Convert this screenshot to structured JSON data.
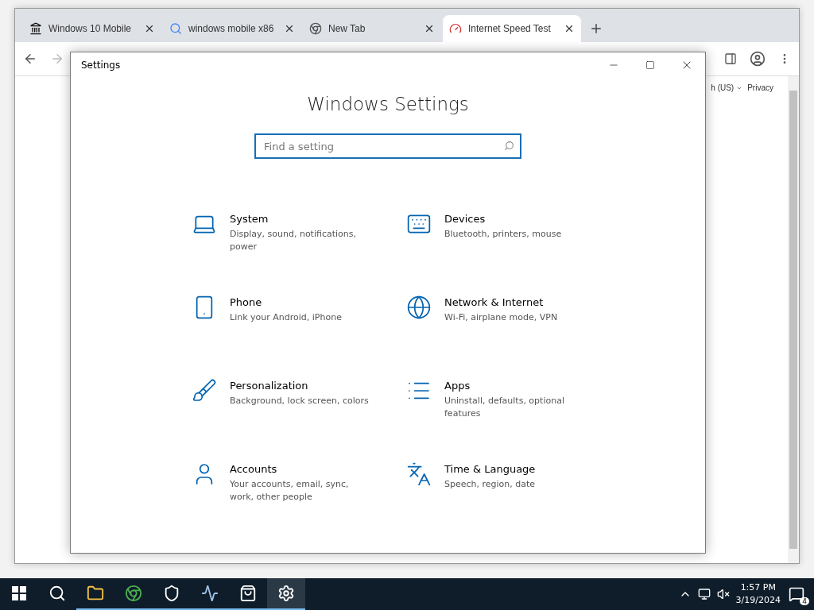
{
  "browser": {
    "tabs": [
      {
        "title": "Windows 10 Mobile",
        "kind": "archive",
        "selected": false
      },
      {
        "title": "windows mobile x86",
        "kind": "google",
        "selected": false
      },
      {
        "title": "New Tab",
        "kind": "chrome",
        "selected": false
      },
      {
        "title": "Internet Speed Test",
        "kind": "gauge",
        "selected": true
      }
    ],
    "page": {
      "language": "h (US)",
      "privacy": "Privacy"
    }
  },
  "settings_window": {
    "title": "Settings",
    "heading": "Windows Settings",
    "search": {
      "placeholder": "Find a setting"
    },
    "categories": [
      {
        "kind": "system",
        "title": "System",
        "description": "Display, sound, notifications, power"
      },
      {
        "kind": "devices",
        "title": "Devices",
        "description": "Bluetooth, printers, mouse"
      },
      {
        "kind": "phone",
        "title": "Phone",
        "description": "Link your Android, iPhone"
      },
      {
        "kind": "network",
        "title": "Network & Internet",
        "description": "Wi-Fi, airplane mode, VPN"
      },
      {
        "kind": "personalization",
        "title": "Personalization",
        "description": "Background, lock screen, colors"
      },
      {
        "kind": "apps",
        "title": "Apps",
        "description": "Uninstall, defaults, optional features"
      },
      {
        "kind": "accounts",
        "title": "Accounts",
        "description": "Your accounts, email, sync, work, other people"
      },
      {
        "kind": "time",
        "title": "Time & Language",
        "description": "Speech, region, date"
      }
    ]
  },
  "taskbar": {
    "apps": [
      {
        "kind": "explorer",
        "running": true,
        "selected": false
      },
      {
        "kind": "chrome",
        "running": true,
        "selected": false
      },
      {
        "kind": "defender",
        "running": true,
        "selected": false
      },
      {
        "kind": "monitor",
        "running": true,
        "selected": false
      },
      {
        "kind": "store",
        "running": true,
        "selected": false
      },
      {
        "kind": "settings",
        "running": true,
        "selected": true
      }
    ],
    "time": "1:57 PM",
    "date": "3/19/2024",
    "notifications": "4"
  }
}
